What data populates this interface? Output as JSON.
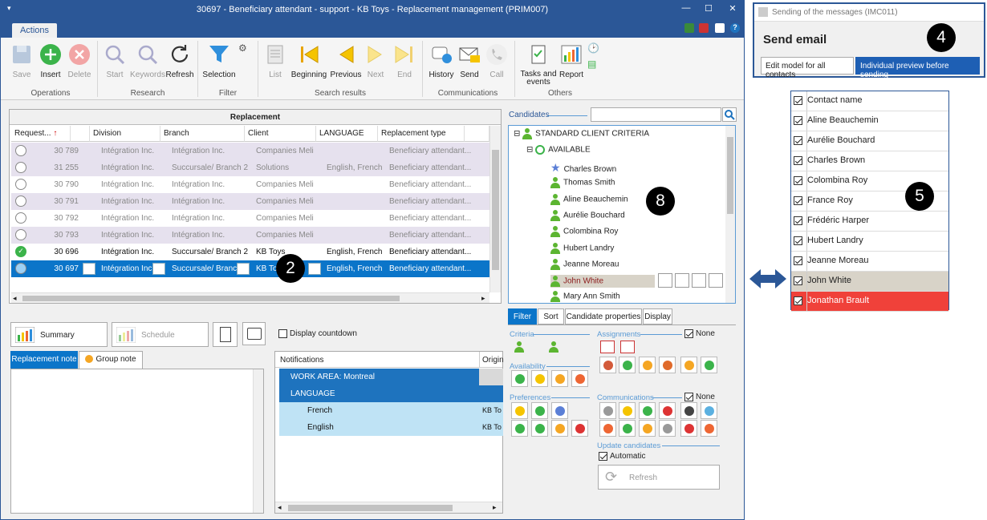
{
  "window": {
    "title": "30697 - Beneficiary attendant - support - KB Toys - Replacement management (PRIM007)",
    "minimize": "—",
    "maximize": "☐",
    "close": "✕"
  },
  "tabs": {
    "actions": "Actions"
  },
  "ribbon": {
    "save": "Save",
    "insert": "Insert",
    "delete": "Delete",
    "start": "Start",
    "keywords": "Keywords",
    "refresh": "Refresh",
    "selection": "Selection",
    "list": "List",
    "beginning": "Beginning",
    "previous": "Previous",
    "next": "Next",
    "end": "End",
    "history": "History",
    "send": "Send",
    "call": "Call",
    "tasks": "Tasks and events",
    "report": "Report",
    "groups": {
      "operations": "Operations",
      "research": "Research",
      "filter": "Filter",
      "search_results": "Search results",
      "communications": "Communications",
      "others": "Others"
    }
  },
  "grid": {
    "title": "Replacement",
    "columns": [
      "Request...",
      "Division",
      "Branch",
      "Client",
      "LANGUAGE",
      "Replacement type"
    ],
    "rows": [
      {
        "id": "30 789",
        "division": "Intégration Inc.",
        "branch": "Intégration Inc.",
        "client": "Companies Meli",
        "language": "",
        "type": "Beneficiary attendant..."
      },
      {
        "id": "31 255",
        "division": "Intégration Inc.",
        "branch": "Succursale/ Branch 2",
        "client": "Solutions",
        "language": "English, French",
        "type": "Beneficiary attendant..."
      },
      {
        "id": "30 790",
        "division": "Intégration Inc.",
        "branch": "Intégration Inc.",
        "client": "Companies Meli",
        "language": "",
        "type": "Beneficiary attendant..."
      },
      {
        "id": "30 791",
        "division": "Intégration Inc.",
        "branch": "Intégration Inc.",
        "client": "Companies Meli",
        "language": "",
        "type": "Beneficiary attendant..."
      },
      {
        "id": "30 792",
        "division": "Intégration Inc.",
        "branch": "Intégration Inc.",
        "client": "Companies Meli",
        "language": "",
        "type": "Beneficiary attendant..."
      },
      {
        "id": "30 793",
        "division": "Intégration Inc.",
        "branch": "Intégration Inc.",
        "client": "Companies Meli",
        "language": "",
        "type": "Beneficiary attendant..."
      },
      {
        "id": "30 696",
        "division": "Intégration Inc.",
        "branch": "Succursale/ Branch 2",
        "client": "KB Toys",
        "language": "English, French",
        "type": "Beneficiary attendant..."
      },
      {
        "id": "30 697",
        "division": "Intégration Inc",
        "branch": "Succursale/ Branch",
        "client": "KB Toys",
        "language": "English, French",
        "type": "Beneficiary attendant..."
      }
    ]
  },
  "candidates": {
    "label": "Candidates",
    "root": "STANDARD CLIENT CRITERIA",
    "group": "AVAILABLE",
    "people": [
      "Charles Brown",
      "Thomas Smith",
      "Aline Beauchemin",
      "Aurélie Bouchard",
      "Colombina Roy",
      "Hubert Landry",
      "Jeanne Moreau",
      "John White",
      "Mary Ann Smith"
    ]
  },
  "panel_tabs": {
    "filter": "Filter",
    "sort": "Sort",
    "candidate_properties": "Candidate properties",
    "display": "Display"
  },
  "filter": {
    "criteria": "Criteria",
    "assignments": "Assignments",
    "none": "None",
    "availability": "Availability",
    "preferences": "Preferences",
    "communications": "Communications",
    "update_candidates": "Update candidates",
    "automatic": "Automatic",
    "refresh": "Refresh"
  },
  "bottom": {
    "summary": "Summary",
    "schedule": "Schedule",
    "display_countdown": "Display countdown",
    "replacement_note": "Replacement note",
    "group_note": "Group note",
    "notifications": "Notifications",
    "origin": "Origin",
    "notif_rows": [
      {
        "label": "WORK AREA: Montreal",
        "origin": ""
      },
      {
        "label": "LANGUAGE",
        "origin": ""
      },
      {
        "label": "French",
        "origin": "KB To"
      },
      {
        "label": "English",
        "origin": "KB To"
      }
    ]
  },
  "email": {
    "window_title": "Sending of the messages (IMC011)",
    "heading": "Send email",
    "edit_model": "Edit model for all contacts",
    "individual_preview": "Individual preview before sending"
  },
  "contacts": [
    "Contact name",
    "Aline Beauchemin",
    "Aurélie Bouchard",
    "Charles Brown",
    "Colombina Roy",
    "France Roy",
    "Frédéric Harper",
    "Hubert Landry",
    "Jeanne Moreau",
    "John White",
    "Jonathan Brault"
  ],
  "badges": {
    "b2": "2",
    "b4": "4",
    "b5": "5",
    "b8": "8"
  },
  "colors": {
    "accent": "#2b5797",
    "selection": "#0b75c9",
    "highlight_red": "#f0413a"
  }
}
